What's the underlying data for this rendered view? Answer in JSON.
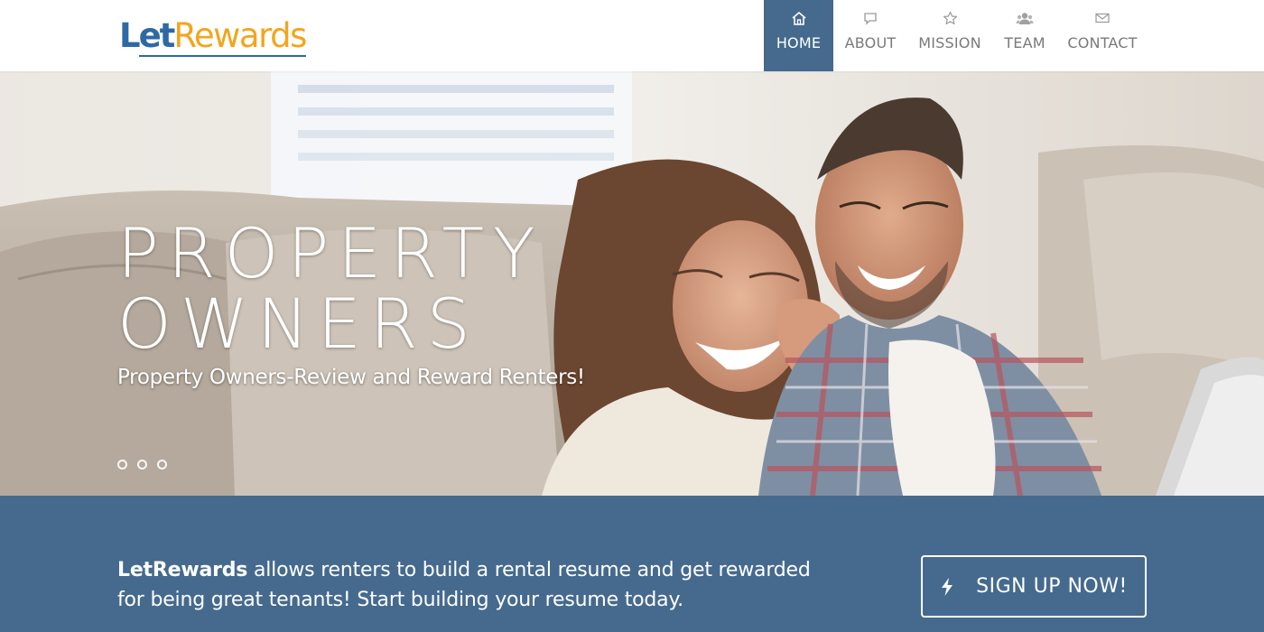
{
  "header": {
    "logo": {
      "part1": "Let",
      "part2": "Rewards"
    },
    "nav": [
      {
        "label": "HOME",
        "icon": "home-icon",
        "active": true
      },
      {
        "label": "ABOUT",
        "icon": "speech-bubble-icon",
        "active": false
      },
      {
        "label": "MISSION",
        "icon": "star-icon",
        "active": false
      },
      {
        "label": "TEAM",
        "icon": "users-icon",
        "active": false
      },
      {
        "label": "CONTACT",
        "icon": "envelope-icon",
        "active": false
      }
    ]
  },
  "hero": {
    "title_line1": "PROPERTY",
    "title_line2": "OWNERS",
    "subtitle": "Property Owners-Review and Reward Renters!",
    "slides": {
      "count": 3,
      "active_index": 0
    }
  },
  "band": {
    "brand": "LetRewards",
    "text": " allows renters to build a rental resume and get rewarded for being great tenants! Start building your resume today.",
    "cta_label": "SIGN UP NOW!",
    "cta_icon": "lightning-bolt-icon"
  },
  "colors": {
    "brand_blue": "#2d6aa5",
    "brand_orange": "#f3a51d",
    "band_blue": "#456a8e",
    "nav_text": "#7a7a7a"
  }
}
